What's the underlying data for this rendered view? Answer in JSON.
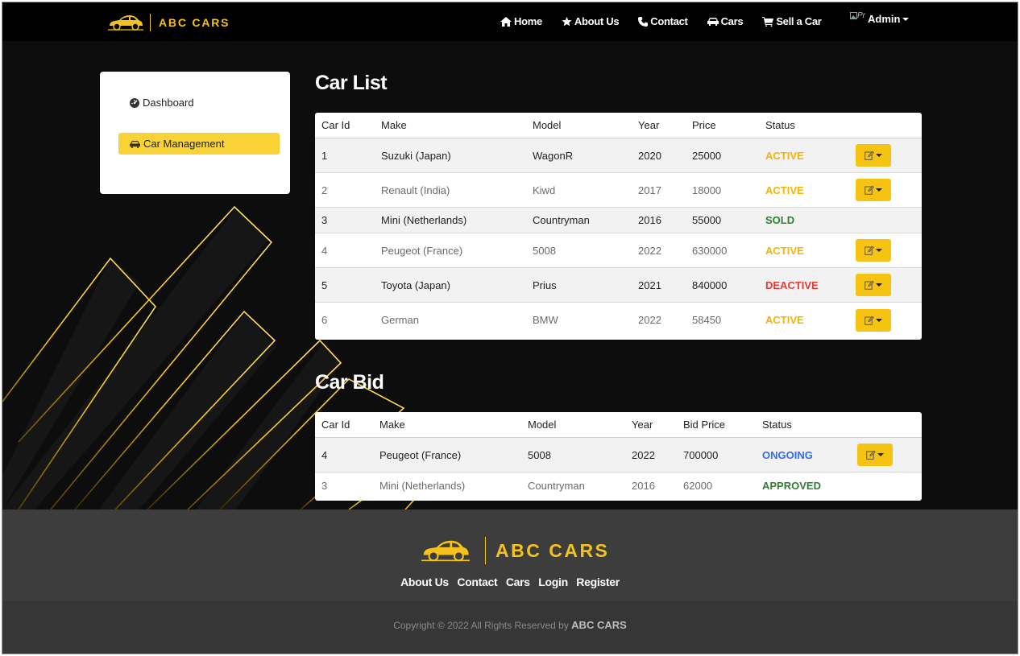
{
  "brand": {
    "name": "ABC CARS"
  },
  "nav": {
    "items": [
      {
        "label": "Home",
        "icon": "home-icon"
      },
      {
        "label": "About Us",
        "icon": "star-icon"
      },
      {
        "label": "Contact",
        "icon": "phone-icon"
      },
      {
        "label": "Cars",
        "icon": "car-icon"
      },
      {
        "label": "Sell a Car",
        "icon": "cart-icon"
      }
    ],
    "user": {
      "avatar_alt": "Pr",
      "name": "Admin"
    }
  },
  "sidebar": {
    "items": [
      {
        "label": "Dashboard",
        "icon": "dashboard-icon",
        "active": false
      },
      {
        "label": "Car Management",
        "icon": "car-icon",
        "active": true
      }
    ]
  },
  "car_list": {
    "title": "Car List",
    "columns": [
      "Car Id",
      "Make",
      "Model",
      "Year",
      "Price",
      "Status"
    ],
    "rows": [
      {
        "id": "1",
        "make": "Suzuki (Japan)",
        "model": "WagonR",
        "year": "2020",
        "price": "25000",
        "status": "ACTIVE",
        "action": true
      },
      {
        "id": "2",
        "make": "Renault (India)",
        "model": "Kiwd",
        "year": "2017",
        "price": "18000",
        "status": "ACTIVE",
        "action": true
      },
      {
        "id": "3",
        "make": "Mini (Netherlands)",
        "model": "Countryman",
        "year": "2016",
        "price": "55000",
        "status": "SOLD",
        "action": false
      },
      {
        "id": "4",
        "make": "Peugeot (France)",
        "model": "5008",
        "year": "2022",
        "price": "630000",
        "status": "ACTIVE",
        "action": true
      },
      {
        "id": "5",
        "make": "Toyota (Japan)",
        "model": "Prius",
        "year": "2021",
        "price": "840000",
        "status": "DEACTIVE",
        "action": true
      },
      {
        "id": "6",
        "make": "German",
        "model": "BMW",
        "year": "2022",
        "price": "58450",
        "status": "ACTIVE",
        "action": true
      }
    ]
  },
  "car_bid": {
    "title": "Car Bid",
    "columns": [
      "Car Id",
      "Make",
      "Model",
      "Year",
      "Bid Price",
      "Status"
    ],
    "rows": [
      {
        "id": "4",
        "make": "Peugeot (France)",
        "model": "5008",
        "year": "2022",
        "price": "700000",
        "status": "ONGOING",
        "action": true
      },
      {
        "id": "3",
        "make": "Mini (Netherlands)",
        "model": "Countryman",
        "year": "2016",
        "price": "62000",
        "status": "APPROVED",
        "action": false
      }
    ]
  },
  "footer": {
    "brand": "ABC CARS",
    "links": [
      "About Us",
      "Contact",
      "Cars",
      "Login",
      "Register"
    ],
    "copyright_prefix": "Copyright © 2022 All Rights Reserved by",
    "copyright_brand": "ABC CARS"
  },
  "colors": {
    "accent": "#f4c21a",
    "active": "#f4b400",
    "sold": "#2e7d32",
    "deactive": "#e53935",
    "ongoing": "#2f6bff",
    "approved": "#2e7d32"
  }
}
